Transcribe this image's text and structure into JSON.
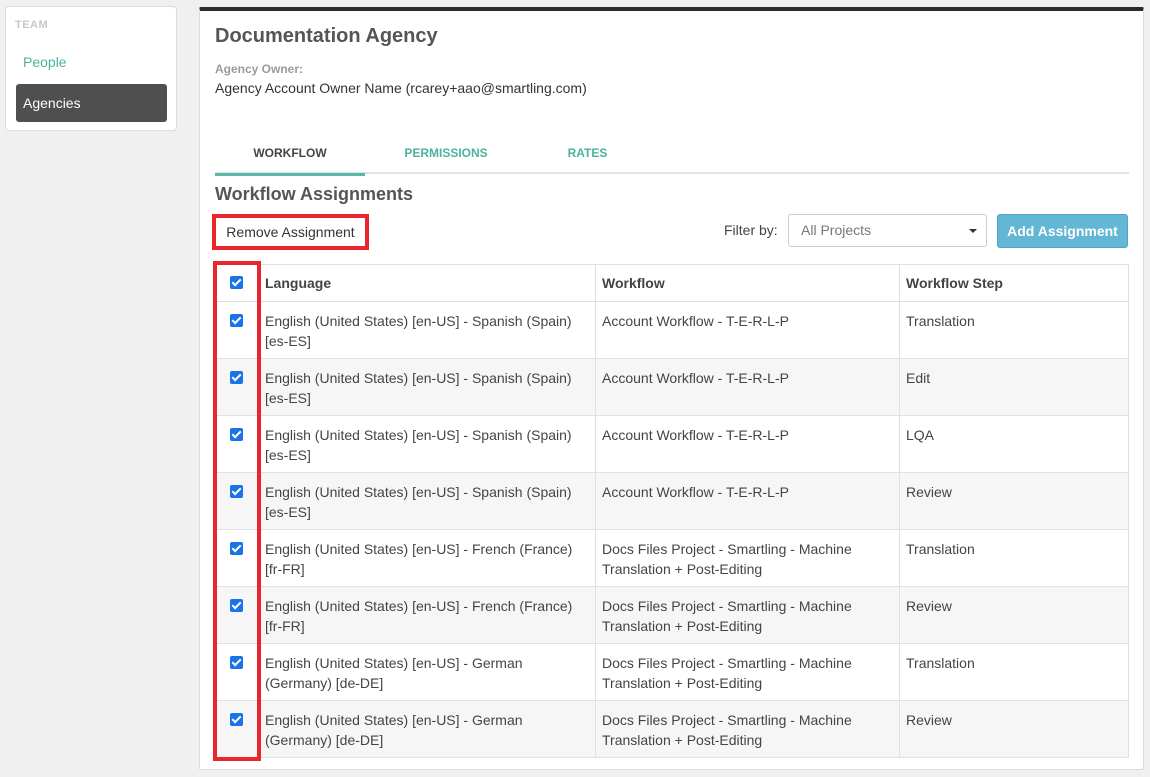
{
  "sidebar": {
    "section_label": "TEAM",
    "items": [
      {
        "label": "People"
      },
      {
        "label": "Agencies"
      }
    ]
  },
  "agency": {
    "title": "Documentation Agency",
    "owner_label": "Agency Owner:",
    "owner_value": "Agency Account Owner Name (rcarey+aao@smartling.com)"
  },
  "tabs": [
    {
      "label": "WORKFLOW",
      "active": true
    },
    {
      "label": "PERMISSIONS",
      "active": false
    },
    {
      "label": "RATES",
      "active": false
    }
  ],
  "section_title": "Workflow Assignments",
  "toolbar": {
    "remove_label": "Remove Assignment",
    "filter_label": "Filter by:",
    "filter_value": "All Projects",
    "add_label": "Add Assignment"
  },
  "table": {
    "headers": [
      "Language",
      "Workflow",
      "Workflow Step"
    ],
    "rows": [
      {
        "language": "English (United States) [en-US] - Spanish (Spain) [es-ES]",
        "workflow": "Account Workflow - T-E-R-L-P",
        "step": "Translation",
        "checked": true
      },
      {
        "language": "English (United States) [en-US] - Spanish (Spain) [es-ES]",
        "workflow": "Account Workflow - T-E-R-L-P",
        "step": "Edit",
        "checked": true
      },
      {
        "language": "English (United States) [en-US] - Spanish (Spain) [es-ES]",
        "workflow": "Account Workflow - T-E-R-L-P",
        "step": "LQA",
        "checked": true
      },
      {
        "language": "English (United States) [en-US] - Spanish (Spain) [es-ES]",
        "workflow": "Account Workflow - T-E-R-L-P",
        "step": "Review",
        "checked": true
      },
      {
        "language": "English (United States) [en-US] - French (France) [fr-FR]",
        "workflow": "Docs Files Project - Smartling - Machine Translation + Post-Editing",
        "step": "Translation",
        "checked": true
      },
      {
        "language": "English (United States) [en-US] - French (France) [fr-FR]",
        "workflow": "Docs Files Project - Smartling - Machine Translation + Post-Editing",
        "step": "Review",
        "checked": true
      },
      {
        "language": "English (United States) [en-US] - German (Germany) [de-DE]",
        "workflow": "Docs Files Project - Smartling - Machine Translation + Post-Editing",
        "step": "Translation",
        "checked": true
      },
      {
        "language": "English (United States) [en-US] - German (Germany) [de-DE]",
        "workflow": "Docs Files Project - Smartling - Machine Translation + Post-Editing",
        "step": "Review",
        "checked": true
      }
    ]
  },
  "colors": {
    "accent_teal": "#4bb39e",
    "add_button": "#62b8d4",
    "highlight_red": "#e8262b",
    "checkbox_blue": "#1a73e8"
  }
}
